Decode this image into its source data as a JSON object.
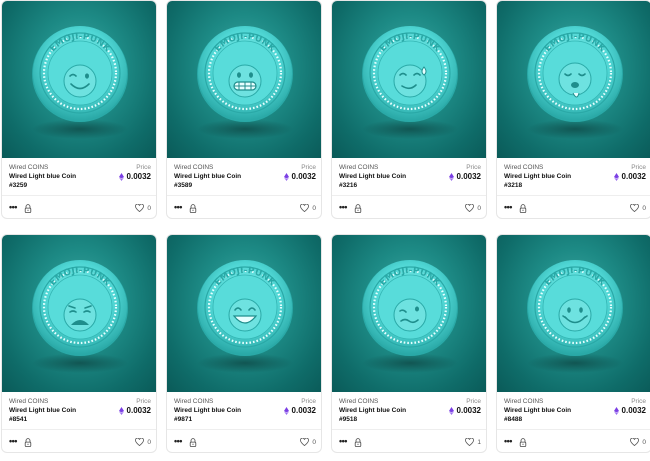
{
  "cards": [
    {
      "collection": "Wired COINS",
      "price_label": "Price",
      "title": "Wired Light blue Coin",
      "price": "0.0032",
      "token_id": "#3259",
      "likes": "0",
      "face": "wink-smile-icon"
    },
    {
      "collection": "Wired COINS",
      "price_label": "Price",
      "title": "Wired Light blue Coin",
      "price": "0.0032",
      "token_id": "#3589",
      "likes": "0",
      "face": "grimace-icon"
    },
    {
      "collection": "Wired COINS",
      "price_label": "Price",
      "title": "Wired Light blue Coin",
      "price": "0.0032",
      "token_id": "#3216",
      "likes": "0",
      "face": "smirk-sweat-icon"
    },
    {
      "collection": "Wired COINS",
      "price_label": "Price",
      "title": "Wired Light blue Coin",
      "price": "0.0032",
      "token_id": "#3218",
      "likes": "0",
      "face": "drool-icon"
    },
    {
      "collection": "Wired COINS",
      "price_label": "Price",
      "title": "Wired Light blue Coin",
      "price": "0.0032",
      "token_id": "#8541",
      "likes": "0",
      "face": "anguished-icon"
    },
    {
      "collection": "Wired COINS",
      "price_label": "Price",
      "title": "Wired Light blue Coin",
      "price": "0.0032",
      "token_id": "#9871",
      "likes": "0",
      "face": "grin-icon"
    },
    {
      "collection": "Wired COINS",
      "price_label": "Price",
      "title": "Wired Light blue Coin",
      "price": "0.0032",
      "token_id": "#9518",
      "likes": "1",
      "face": "woozy-icon"
    },
    {
      "collection": "Wired COINS",
      "price_label": "Price",
      "title": "Wired Light blue Coin",
      "price": "0.0032",
      "token_id": "#8488",
      "likes": "0",
      "face": "smiley-icon"
    }
  ],
  "coin_text": "EMOJI-PUNK",
  "colors": {
    "coin": "#4fd6d4",
    "coin_dark": "#2aa9a7",
    "bg_dark": "#0a5a58",
    "eth": "#7b3fe4"
  },
  "icons": {
    "menu": "more-dots-icon",
    "lock": "lock-icon",
    "like": "heart-icon",
    "currency": "ethereum-icon"
  }
}
